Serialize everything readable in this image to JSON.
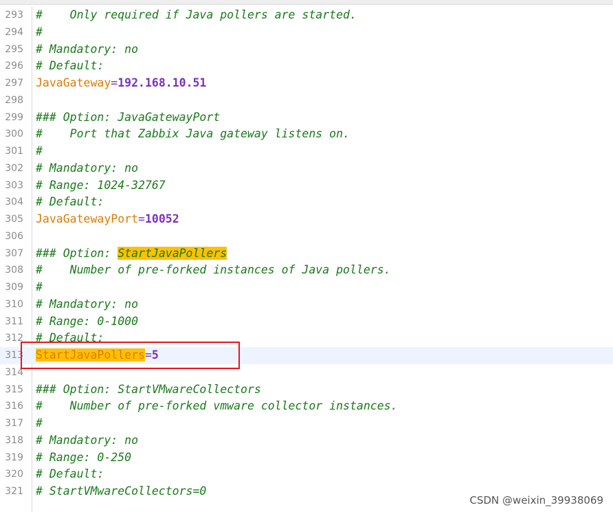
{
  "editor": {
    "lines": [
      {
        "num": "293",
        "segments": [
          {
            "t": "#    Only required if Java pollers are started.",
            "c": "comment"
          }
        ]
      },
      {
        "num": "294",
        "segments": [
          {
            "t": "#",
            "c": "comment"
          }
        ]
      },
      {
        "num": "295",
        "segments": [
          {
            "t": "# Mandatory: no",
            "c": "comment"
          }
        ]
      },
      {
        "num": "296",
        "segments": [
          {
            "t": "# Default:",
            "c": "comment"
          }
        ]
      },
      {
        "num": "297",
        "segments": [
          {
            "t": "JavaGateway",
            "c": "key"
          },
          {
            "t": "=",
            "c": "eq"
          },
          {
            "t": "192.168.10.51",
            "c": "val"
          }
        ]
      },
      {
        "num": "298",
        "segments": []
      },
      {
        "num": "299",
        "segments": [
          {
            "t": "### Option: JavaGatewayPort",
            "c": "comment"
          }
        ]
      },
      {
        "num": "300",
        "segments": [
          {
            "t": "#    Port that Zabbix Java gateway listens on.",
            "c": "comment"
          }
        ]
      },
      {
        "num": "301",
        "segments": [
          {
            "t": "#",
            "c": "comment"
          }
        ]
      },
      {
        "num": "302",
        "segments": [
          {
            "t": "# Mandatory: no",
            "c": "comment"
          }
        ]
      },
      {
        "num": "303",
        "segments": [
          {
            "t": "# Range: 1024-32767",
            "c": "comment"
          }
        ]
      },
      {
        "num": "304",
        "segments": [
          {
            "t": "# Default:",
            "c": "comment"
          }
        ]
      },
      {
        "num": "305",
        "segments": [
          {
            "t": "JavaGatewayPort",
            "c": "key"
          },
          {
            "t": "=",
            "c": "eq"
          },
          {
            "t": "10052",
            "c": "val"
          }
        ]
      },
      {
        "num": "306",
        "segments": []
      },
      {
        "num": "307",
        "segments": [
          {
            "t": "### Option: ",
            "c": "comment"
          },
          {
            "t": "StartJavaPollers",
            "c": "comment hl"
          }
        ]
      },
      {
        "num": "308",
        "segments": [
          {
            "t": "#    Number of pre-forked instances of Java pollers.",
            "c": "comment"
          }
        ]
      },
      {
        "num": "309",
        "segments": [
          {
            "t": "#",
            "c": "comment"
          }
        ]
      },
      {
        "num": "310",
        "segments": [
          {
            "t": "# Mandatory: no",
            "c": "comment"
          }
        ]
      },
      {
        "num": "311",
        "segments": [
          {
            "t": "# Range: 0-1000",
            "c": "comment"
          }
        ]
      },
      {
        "num": "312",
        "segments": [
          {
            "t": "# Default:",
            "c": "comment"
          }
        ]
      },
      {
        "num": "313",
        "current": true,
        "segments": [
          {
            "t": "StartJavaPollers",
            "c": "key hl"
          },
          {
            "t": "=",
            "c": "eq"
          },
          {
            "t": "5",
            "c": "val"
          }
        ]
      },
      {
        "num": "314",
        "segments": []
      },
      {
        "num": "315",
        "segments": [
          {
            "t": "### Option: StartVMwareCollectors",
            "c": "comment"
          }
        ]
      },
      {
        "num": "316",
        "segments": [
          {
            "t": "#    Number of pre-forked vmware collector instances.",
            "c": "comment"
          }
        ]
      },
      {
        "num": "317",
        "segments": [
          {
            "t": "#",
            "c": "comment"
          }
        ]
      },
      {
        "num": "318",
        "segments": [
          {
            "t": "# Mandatory: no",
            "c": "comment"
          }
        ]
      },
      {
        "num": "319",
        "segments": [
          {
            "t": "# Range: 0-250",
            "c": "comment"
          }
        ]
      },
      {
        "num": "320",
        "segments": [
          {
            "t": "# Default:",
            "c": "comment"
          }
        ]
      },
      {
        "num": "321",
        "segments": [
          {
            "t": "# StartVMwareCollectors=0",
            "c": "comment"
          }
        ]
      }
    ]
  },
  "watermark": "CSDN @weixin_39938069",
  "colors": {
    "comment": "#1a7a1a",
    "key": "#e07b00",
    "value": "#7b2fbf",
    "highlight": "#ffc000",
    "annotation_box": "#e8131b"
  }
}
